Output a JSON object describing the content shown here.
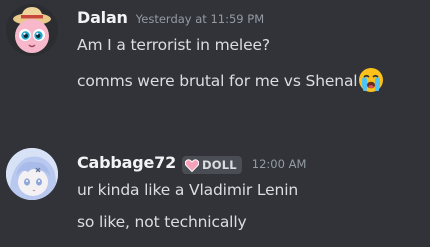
{
  "messages": [
    {
      "author": "Dalan",
      "timestamp": "Yesterday at 11:59 PM",
      "avatar_icon": "jigglypuff-avatar-icon",
      "lines": [
        "Am I a terrorist in melee?",
        "comms were brutal for me vs Shenal"
      ],
      "emoji": "loudly-crying-face-icon"
    },
    {
      "author": "Cabbage72",
      "role_badge": "DOLL",
      "role_icon": "pink-heart-icon",
      "timestamp": "12:00 AM",
      "avatar_icon": "anime-girl-avatar-icon",
      "lines": [
        "ur kinda like a Vladimir Lenin",
        "so like, not technically"
      ]
    }
  ],
  "colors": {
    "background": "#313338",
    "username": "#f2f3f5",
    "message_text": "#dbdee1",
    "timestamp": "#949ba4",
    "badge_bg": "#4b4d55"
  }
}
